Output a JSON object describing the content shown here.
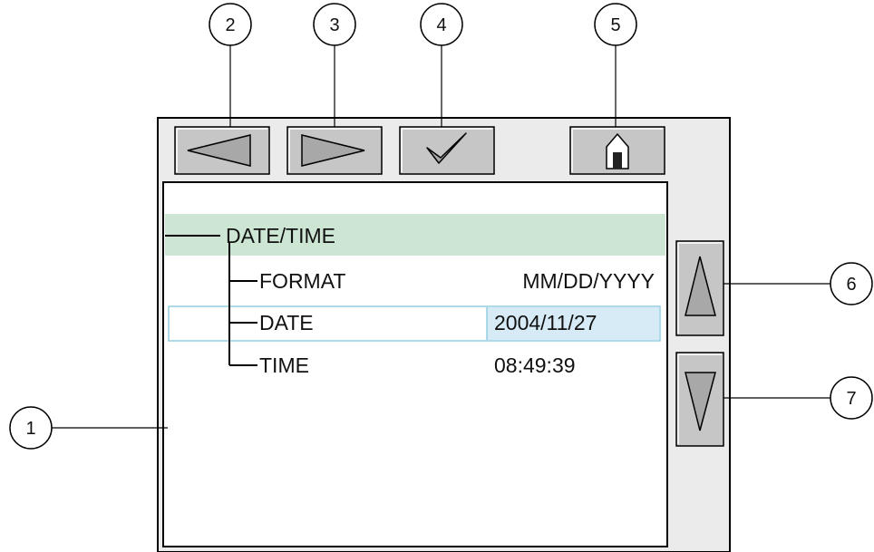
{
  "callouts": [
    "1",
    "2",
    "3",
    "4",
    "5",
    "6",
    "7"
  ],
  "toolbar": {
    "back_icon": "left-arrow-icon",
    "forward_icon": "right-arrow-icon",
    "confirm_icon": "checkmark-icon",
    "home_icon": "home-icon"
  },
  "menu": {
    "title": "DATE/TIME",
    "items": [
      {
        "label": "FORMAT",
        "value": "MM/DD/YYYY",
        "selected": false
      },
      {
        "label": "DATE",
        "value": "2004/11/27",
        "selected": true
      },
      {
        "label": "TIME",
        "value": "08:49:39",
        "selected": false
      }
    ]
  },
  "scroll": {
    "up_icon": "up-arrow-icon",
    "down_icon": "down-arrow-icon"
  },
  "colors": {
    "device_frame": "#ebebeb",
    "button_face": "#c6c6c6",
    "title_highlight": "#cce6d3",
    "selected_value_bg": "#d6ebf5",
    "selected_row_border": "#94cde0"
  }
}
